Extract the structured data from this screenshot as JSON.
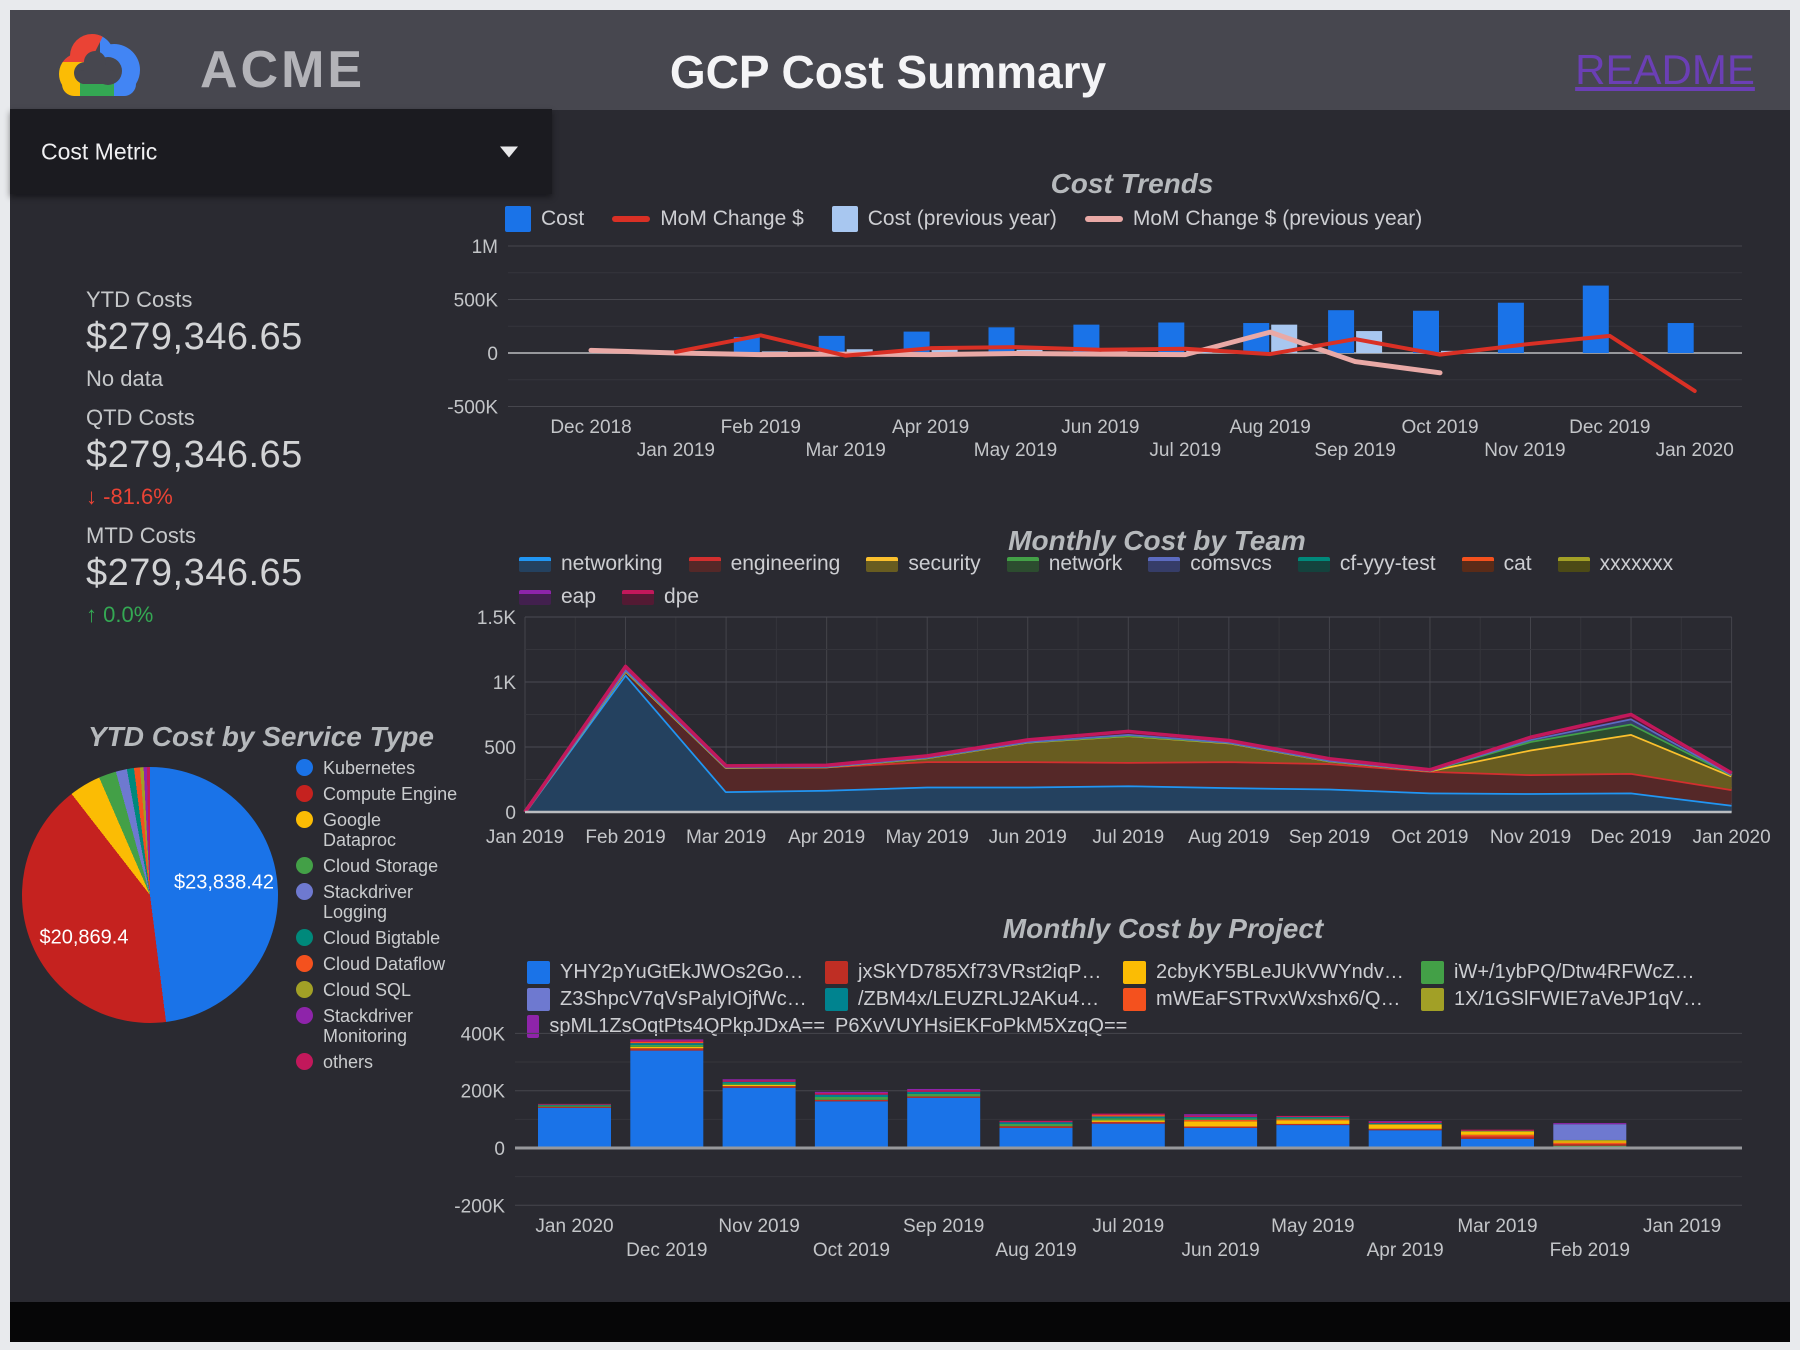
{
  "header": {
    "brand": "ACME",
    "title": "GCP Cost Summary",
    "readme_label": "README",
    "readme_color": "#6b3fb5",
    "bg": "#47474f"
  },
  "filter": {
    "label": "Cost Metric"
  },
  "scorecards": [
    {
      "label": "YTD Costs",
      "value": "$279,346.65",
      "delta": "No data",
      "arrow": "",
      "direction": "none"
    },
    {
      "label": "QTD Costs",
      "value": "$279,346.65",
      "delta": "-81.6%",
      "arrow": "↓",
      "direction": "down"
    },
    {
      "label": "MTD Costs",
      "value": "$279,346.65",
      "delta": "0.0%",
      "arrow": "↑",
      "direction": "up"
    }
  ],
  "palette": {
    "page_bg": "#2a2a31",
    "frame": "#e8eaed",
    "footer": "#060607",
    "grid_minor": "#35353c",
    "grid_major": "#46464d",
    "grid_zero": "#97989c",
    "axis_text": "#c3c5c8"
  },
  "chart_data": [
    {
      "id": "service_pie",
      "type": "pie",
      "title": "YTD Cost by Service Type",
      "slices": [
        {
          "name": "Kubernetes",
          "color": "#1a73e8",
          "pct": 48.0,
          "label": "$23,838.42"
        },
        {
          "name": "Compute Engine",
          "color": "#c5221f",
          "pct": 41.5,
          "label": "$20,869.4"
        },
        {
          "name": "Google Dataproc",
          "color": "#fbbc04",
          "pct": 4.0
        },
        {
          "name": "Cloud Storage",
          "color": "#43a047",
          "pct": 2.2
        },
        {
          "name": "Stackdriver Logging",
          "color": "#6e79d0",
          "pct": 1.4
        },
        {
          "name": "Cloud Bigtable",
          "color": "#00897b",
          "pct": 0.9
        },
        {
          "name": "Cloud Dataflow",
          "color": "#f4511e",
          "pct": 0.75
        },
        {
          "name": "Cloud SQL",
          "color": "#a2a026",
          "pct": 0.45
        },
        {
          "name": "Stackdriver Monitoring",
          "color": "#8e24aa",
          "pct": 0.4
        },
        {
          "name": "others",
          "color": "#c2185b",
          "pct": 0.4
        }
      ]
    },
    {
      "id": "cost_trends",
      "type": "bar+line",
      "title": "Cost Trends",
      "units": "K",
      "ylim": [
        -500,
        1000
      ],
      "yticks": [
        {
          "v": 1000,
          "label": "1M"
        },
        {
          "v": 500,
          "label": "500K"
        },
        {
          "v": 0,
          "label": "0"
        },
        {
          "v": -500,
          "label": "-500K"
        }
      ],
      "yminor": [
        750,
        250,
        -250
      ],
      "categories": [
        "Dec 2018",
        "Jan 2019",
        "Feb 2019",
        "Mar 2019",
        "Apr 2019",
        "May 2019",
        "Jun 2019",
        "Jul 2019",
        "Aug 2019",
        "Sep 2019",
        "Oct 2019",
        "Nov 2019",
        "Dec 2019",
        "Jan 2020"
      ],
      "series": [
        {
          "name": "Cost",
          "kind": "bar",
          "color": "#1a73e8",
          "values": [
            0,
            15,
            150,
            160,
            200,
            240,
            265,
            285,
            280,
            400,
            395,
            470,
            630,
            280
          ]
        },
        {
          "name": "MoM Change $",
          "kind": "line",
          "color": "#d93025",
          "values": [
            null,
            10,
            165,
            -25,
            45,
            55,
            30,
            40,
            -10,
            130,
            -15,
            80,
            160,
            -355
          ]
        },
        {
          "name": "Cost (previous year)",
          "kind": "bar",
          "color": "#a8c7f0",
          "values": [
            30,
            10,
            15,
            35,
            60,
            30,
            40,
            35,
            265,
            205,
            20,
            0,
            0,
            0
          ]
        },
        {
          "name": "MoM Change $ (previous year)",
          "kind": "line",
          "color": "#e9a9a6",
          "values": [
            25,
            0,
            -15,
            -10,
            -15,
            -5,
            -10,
            -15,
            195,
            -80,
            -185,
            null,
            null,
            null
          ]
        }
      ]
    },
    {
      "id": "team",
      "type": "area",
      "title": "Monthly Cost by Team",
      "ylim": [
        0,
        1500
      ],
      "yticks": [
        {
          "v": 1500,
          "label": "1.5K"
        },
        {
          "v": 1000,
          "label": "1K"
        },
        {
          "v": 500,
          "label": "500"
        },
        {
          "v": 0,
          "label": "0"
        }
      ],
      "yminor": [
        1250,
        750,
        250
      ],
      "categories": [
        "Jan 2019",
        "Feb 2019",
        "Mar 2019",
        "Apr 2019",
        "May 2019",
        "Jun 2019",
        "Jul 2019",
        "Aug 2019",
        "Sep 2019",
        "Oct 2019",
        "Nov 2019",
        "Dec 2019",
        "Jan 2020"
      ],
      "series": [
        {
          "name": "networking",
          "color": "#2196f3",
          "fill": "#24415f",
          "values": [
            0,
            1060,
            160,
            170,
            195,
            195,
            205,
            190,
            180,
            150,
            145,
            150,
            55
          ]
        },
        {
          "name": "engineering",
          "color": "#d32f2f",
          "fill": "#552828",
          "values": [
            0,
            30,
            185,
            180,
            195,
            195,
            180,
            200,
            195,
            165,
            145,
            150,
            120
          ]
        },
        {
          "name": "security",
          "color": "#fbc02d",
          "fill": "#685c20",
          "values": [
            0,
            0,
            0,
            0,
            30,
            150,
            205,
            145,
            20,
            5,
            190,
            300,
            105
          ]
        },
        {
          "name": "network",
          "color": "#43a047",
          "fill": "#2c4c2f",
          "values": [
            0,
            5,
            3,
            2,
            2,
            2,
            2,
            2,
            2,
            2,
            65,
            80,
            8
          ]
        },
        {
          "name": "comsvcs",
          "color": "#5c6bc0",
          "fill": "#363d68",
          "values": [
            0,
            5,
            2,
            2,
            2,
            2,
            8,
            2,
            2,
            1,
            15,
            40,
            4
          ]
        },
        {
          "name": "cf-yyy-test",
          "color": "#00897b",
          "fill": "#14423d",
          "values": [
            0,
            0,
            0,
            0,
            0,
            0,
            0,
            0,
            0,
            0,
            0,
            0,
            0
          ]
        },
        {
          "name": "cat",
          "color": "#f4511e",
          "fill": "#5a2b18",
          "values": [
            0,
            0,
            0,
            0,
            0,
            0,
            0,
            0,
            0,
            0,
            0,
            0,
            0
          ]
        },
        {
          "name": "xxxxxxx",
          "color": "#a2a026",
          "fill": "#4c4a16",
          "values": [
            0,
            0,
            0,
            0,
            0,
            0,
            0,
            0,
            0,
            0,
            0,
            0,
            0
          ]
        },
        {
          "name": "eap",
          "color": "#8e24aa",
          "fill": "#42204e",
          "values": [
            0,
            0,
            0,
            0,
            0,
            0,
            0,
            0,
            0,
            0,
            0,
            0,
            0
          ]
        },
        {
          "name": "dpe",
          "color": "#c2185b",
          "fill": "#531a33",
          "values": [
            0,
            20,
            5,
            6,
            8,
            11,
            20,
            11,
            11,
            2,
            15,
            30,
            8
          ]
        }
      ]
    },
    {
      "id": "project",
      "type": "stacked-bar",
      "title": "Monthly Cost by Project",
      "units": "K",
      "ylim": [
        -200,
        400
      ],
      "yticks": [
        {
          "v": 400,
          "label": "400K"
        },
        {
          "v": 200,
          "label": "200K"
        },
        {
          "v": 0,
          "label": "0"
        },
        {
          "v": -200,
          "label": "-200K"
        }
      ],
      "yminor": [
        300,
        100,
        -100
      ],
      "categories": [
        "Jan 2020",
        "Dec 2019",
        "Nov 2019",
        "Oct 2019",
        "Sep 2019",
        "Aug 2019",
        "Jul 2019",
        "Jun 2019",
        "May 2019",
        "Apr 2019",
        "Mar 2019",
        "Feb 2019",
        "Jan 2019"
      ],
      "legend": [
        {
          "name": "YHY2pYuGtEkJWOs2Go…",
          "color": "#1a73e8"
        },
        {
          "name": "jxSkYD785Xf73VRst2iqP…",
          "color": "#bf2e24"
        },
        {
          "name": "2cbyKY5BLeJUkVWYndv…",
          "color": "#fbbc04"
        },
        {
          "name": "iW+/1ybPQ/Dtw4RFWcZ…",
          "color": "#43a047"
        },
        {
          "name": "Z3ShpcV7qVsPalyIOjfWc…",
          "color": "#6e79d0"
        },
        {
          "name": "/ZBM4x/LEUZRLJ2AKu4…",
          "color": "#00838f"
        },
        {
          "name": "mWEaFSTRvxWxshx6/Q…",
          "color": "#f4511e"
        },
        {
          "name": "1X/1GSlFWIE7aVeJP1qV…",
          "color": "#a2a026"
        },
        {
          "name": "spML1ZsOqtPts4QPkpJDxA==",
          "color": "#8e24aa"
        },
        {
          "name": "P6XvVUYHsiEKFoPkM5XzqQ==",
          "color": "#c2185b"
        }
      ],
      "bars": [
        {
          "segs": [
            [
              0,
              140
            ],
            [
              1,
              4
            ],
            [
              3,
              4
            ],
            [
              5,
              3
            ],
            [
              9,
              3
            ]
          ]
        },
        {
          "segs": [
            [
              0,
              340
            ],
            [
              1,
              8
            ],
            [
              2,
              5
            ],
            [
              3,
              7
            ],
            [
              5,
              6
            ],
            [
              6,
              4
            ],
            [
              9,
              5
            ],
            [
              8,
              4
            ]
          ]
        },
        {
          "segs": [
            [
              0,
              210
            ],
            [
              1,
              6
            ],
            [
              2,
              4
            ],
            [
              3,
              6
            ],
            [
              5,
              5
            ],
            [
              9,
              5
            ],
            [
              8,
              4
            ]
          ]
        },
        {
          "segs": [
            [
              0,
              163
            ],
            [
              1,
              5
            ],
            [
              3,
              10
            ],
            [
              5,
              8
            ],
            [
              9,
              6
            ],
            [
              8,
              4
            ]
          ]
        },
        {
          "segs": [
            [
              0,
              175
            ],
            [
              1,
              5
            ],
            [
              3,
              9
            ],
            [
              5,
              7
            ],
            [
              9,
              6
            ],
            [
              8,
              4
            ]
          ]
        },
        {
          "segs": [
            [
              0,
              70
            ],
            [
              1,
              6
            ],
            [
              3,
              8
            ],
            [
              5,
              6
            ],
            [
              9,
              5
            ]
          ]
        },
        {
          "segs": [
            [
              0,
              85
            ],
            [
              1,
              6
            ],
            [
              2,
              5
            ],
            [
              3,
              8
            ],
            [
              5,
              6
            ],
            [
              6,
              5
            ],
            [
              9,
              5
            ]
          ]
        },
        {
          "segs": [
            [
              0,
              70
            ],
            [
              1,
              5
            ],
            [
              2,
              18
            ],
            [
              6,
              5
            ],
            [
              3,
              5
            ],
            [
              5,
              5
            ],
            [
              9,
              5
            ],
            [
              8,
              5
            ]
          ]
        },
        {
          "segs": [
            [
              0,
              80
            ],
            [
              1,
              4
            ],
            [
              2,
              12
            ],
            [
              6,
              4
            ],
            [
              3,
              4
            ],
            [
              5,
              4
            ],
            [
              9,
              4
            ]
          ]
        },
        {
          "segs": [
            [
              0,
              62
            ],
            [
              1,
              5
            ],
            [
              2,
              14
            ],
            [
              7,
              3
            ],
            [
              5,
              3
            ],
            [
              9,
              4
            ],
            [
              8,
              3
            ]
          ]
        },
        {
          "segs": [
            [
              0,
              32
            ],
            [
              1,
              8
            ],
            [
              6,
              6
            ],
            [
              2,
              10
            ],
            [
              7,
              4
            ],
            [
              9,
              4
            ]
          ]
        },
        {
          "segs": [
            [
              0,
              5
            ],
            [
              3,
              3
            ],
            [
              1,
              5
            ],
            [
              6,
              5
            ],
            [
              2,
              6
            ],
            [
              7,
              4
            ],
            [
              4,
              55
            ],
            [
              8,
              4
            ]
          ]
        },
        {
          "segs": []
        }
      ]
    }
  ]
}
